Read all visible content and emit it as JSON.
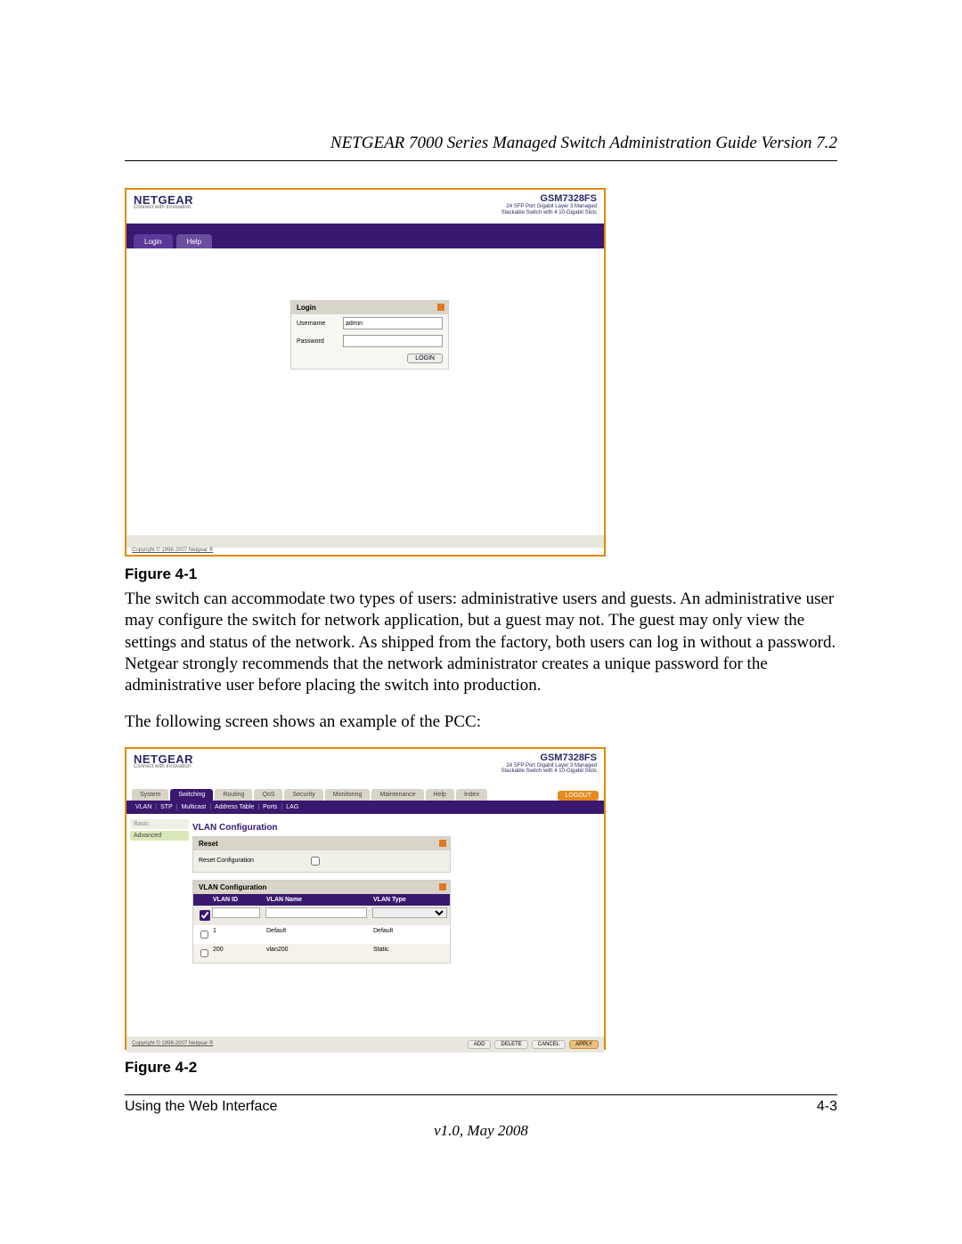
{
  "doc": {
    "header_title": "NETGEAR 7000 Series Managed Switch Administration Guide Version 7.2",
    "fig1_label": "Figure 4-1",
    "para1": "The switch can accommodate two types of users: administrative users and guests. An administrative user may configure the switch for network application, but a guest may not. The guest may only view the settings and status of the network. As shipped from the factory, both users can log in without a password. Netgear strongly recommends that the network administrator creates a unique password for the administrative user before placing the switch into production.",
    "para2": "The following screen shows an example of the PCC:",
    "fig2_label": "Figure 4-2",
    "footer_left": "Using the Web Interface",
    "footer_right": "4-3",
    "footer_version": "v1.0, May 2008"
  },
  "netgear": {
    "logo": "NETGEAR",
    "tagline": "Connect with Innovation",
    "model": "GSM7328FS",
    "model_desc1": "24 SFP Port Gigabit Layer 3 Managed",
    "model_desc2": "Stackable Switch with 4 10-Gigabit Slots",
    "copyright": "Copyright © 1996-2007 Netgear ®"
  },
  "login": {
    "tab_login": "Login",
    "tab_help": "Help",
    "panel_title": "Login",
    "username_label": "Username",
    "username_value": "admin",
    "password_label": "Password",
    "password_value": "",
    "button": "LOGIN"
  },
  "pcc": {
    "mainnav": [
      "System",
      "Switching",
      "Routing",
      "QoS",
      "Security",
      "Monitoring",
      "Maintenance",
      "Help",
      "Index"
    ],
    "mainnav_active": "Switching",
    "logout": "LOGOUT",
    "subnav": [
      "VLAN",
      "STP",
      "Multicast",
      "Address Table",
      "Ports",
      "LAG"
    ],
    "side": {
      "basic": "Basic",
      "advanced": "Advanced"
    },
    "vlan_conf_title": "VLAN Configuration",
    "reset_title": "Reset",
    "reset_label": "Reset Configuration",
    "table_title": "VLAN Configuration",
    "thead": {
      "id": "VLAN ID",
      "name": "VLAN Name",
      "type": "VLAN Type"
    },
    "rows": [
      {
        "id": "1",
        "name": "Default",
        "type": "Default"
      },
      {
        "id": "200",
        "name": "vlan200",
        "type": "Static"
      }
    ],
    "buttons": {
      "add": "ADD",
      "delete": "DELETE",
      "cancel": "CANCEL",
      "apply": "APPLY"
    }
  }
}
